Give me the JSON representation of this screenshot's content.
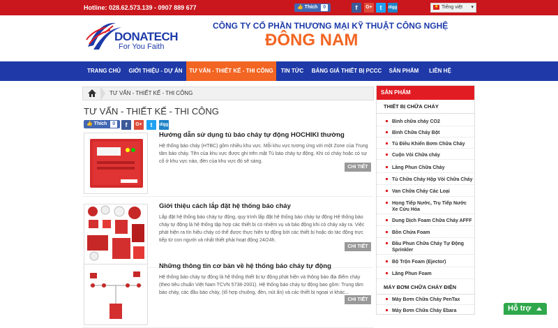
{
  "topbar": {
    "hotline": "Hotline: 028.62.573.139  -  0907 889 677",
    "like_label": "Thích",
    "like_count": "0",
    "social": [
      "f",
      "G+",
      "t",
      "digg"
    ],
    "language": "Tiếng việt"
  },
  "header": {
    "logo_text": "DONATECH",
    "logo_tagline": "For You Faith",
    "company_line": "CÔNG TY CỔ PHẦN THƯƠNG MẠI KỸ THUẬT CÔNG NGHỆ",
    "company_name": "ĐÔNG NAM"
  },
  "nav": {
    "items": [
      {
        "label": "TRANG CHỦ"
      },
      {
        "label": "GIỚI THIỆU - DỰ ÁN"
      },
      {
        "label": "TƯ VẤN - THIẾT KẾ - THI CÔNG"
      },
      {
        "label": "TIN TỨC"
      },
      {
        "label": "BẢNG GIÁ THIẾT BỊ PCCC"
      },
      {
        "label": "SẢN PHẨM"
      },
      {
        "label": "LIÊN HỆ"
      }
    ],
    "active_index": 2
  },
  "breadcrumb": {
    "current": "TƯ VẤN - THIẾT KẾ - THI CÔNG"
  },
  "page": {
    "title": "TƯ VẤN - THIẾT KẾ - THI CÔNG",
    "like_label": "Thích",
    "like_count": "0",
    "social": [
      "f",
      "G+",
      "t",
      "digg"
    ]
  },
  "articles": [
    {
      "title": "Hướng dẫn sử dụng tủ báo cháy tự động HOCHIKI thường",
      "desc": "Hệ thống báo cháy (HTBC) gồm nhiều khu vực. Mỗi khu vực tương ứng với một Zone của Trung tâm báo cháy. Tên của khu vực được ghi trên mặt Tủ báo cháy tự động. Khi có cháy hoặc có sự cố ở khu vực nào, đèn của khu vực đó sẽ sáng.",
      "button": "CHI TIẾT"
    },
    {
      "title": "Giới thiệu cách lắp đặt hệ thống báo cháy",
      "desc": "Lắp đặt hệ thống báo cháy tự động, quy trình lắp đặt hệ thống báo cháy tự động Hệ thống báo cháy tự động là hệ thống tập hợp các thiết bị có nhiệm vụ và báo động khi có cháy xảy ra. Việc phát hiện ra tín hiệu cháy có thể được thực hiện tự động bởi các thiết bị hoặc do tác động trực tiếp từ con người và nhất thiết phải hoạt động 24/24h.",
      "button": "CHI TIẾT"
    },
    {
      "title": "Những thông tin cơ bản về hệ thống báo cháy tự động",
      "desc": "Hệ thống báo cháy tự động là hệ thống thiết bị tự động phát hiện và thông báo địa điểm cháy (theo tiêu chuẩn Việt Nam TCVN 5738-2001). Hệ thống báo cháy tự động bao gồm: Trung tâm báo cháy, các đầu báo cháy, (tổ hợp chuông, đèn, nút ấn) và các thiết bị ngoại vi khác...",
      "button": "CHI TIẾT"
    }
  ],
  "sidebar": {
    "header": "SẢN PHẨM",
    "cat1": "THIẾT BỊ CHỮA CHÁY",
    "cat1_items": [
      "Bình chữa cháy CO2",
      "Bình Chữa Cháy Bột",
      "Tủ Điều Khiển Bơm Chữa Cháy",
      "Cuộn Vòi Chữa cháy",
      "Lăng Phun Chữa Cháy",
      "Tủ Chữa Cháy Hộp Vòi Chữa Cháy",
      "Van Chữa Cháy Các Loại",
      "Họng Tiếp Nước, Trụ Tiếp Nước Xe Cứu Hỏa",
      "Dung Dịch Foam Chữa Cháy AFFF",
      "Bồn Chứa Foam",
      "Đầu Phun Chữa Cháy Tự Động Sprinkler",
      "Bộ Trộn Foam (Ejector)",
      "Lăng Phun Foam"
    ],
    "cat2": "MÁY BƠM CHỮA CHÁY ĐIỆN",
    "cat2_items": [
      "Máy Bơm Chữa Cháy PenTax",
      "Máy Bơm Chữa Cháy Ebara"
    ]
  },
  "support": {
    "label": "Hỗ trợ"
  },
  "colors": {
    "topbar": "#c9171d",
    "nav": "#1f3aa8",
    "accent": "#f26522",
    "sidebar_header": "#e21c23",
    "support": "#2ea84b"
  }
}
